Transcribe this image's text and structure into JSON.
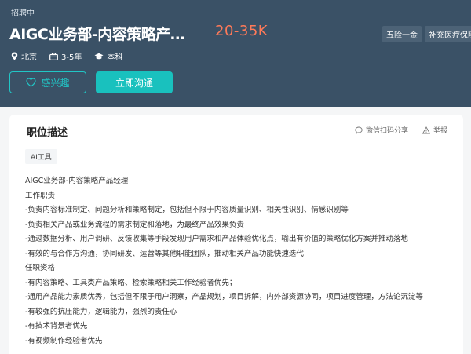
{
  "header": {
    "status": "招聘中",
    "title": "AIGC业务部-内容策略产品经理",
    "salary": "20-35K",
    "tags": [
      "五险一金",
      "补充医疗保险"
    ],
    "meta": {
      "location": "北京",
      "experience": "3-5年",
      "education": "本科"
    },
    "interest_button": "感兴趣",
    "chat_button": "立即沟通"
  },
  "card": {
    "title": "职位描述",
    "actions": {
      "share": "微信扫码分享",
      "report": "举报"
    },
    "skill_tag": "AI工具",
    "lines": [
      "AIGC业务部-内容策略产品经理",
      "工作职责",
      "-负责内容标准制定、问题分析和策略制定，包括但不限于内容质量识别、相关性识别、情感识别等",
      "-负责相关产品或业务流程的需求制定和落地，为最终产品效果负责",
      "-通过数据分析、用户调研、反馈收集等手段发现用户需求和产品体验优化点，输出有价值的策略优化方案并推动落地",
      "-有效的与合作方沟通，协同研发、运营等其他职能团队，推动相关产品功能快速迭代",
      "任职资格",
      "-有内容策略、工具类产品策略、检索策略相关工作经验者优先；",
      "-通用产品能力素质优秀，包括但不限于用户洞察，产品规划，项目拆解，内外部资源协同，项目进度管理，方法论沉淀等",
      "-有较强的抗压能力，逻辑能力，强烈的责任心",
      "-有技术背景者优先",
      "-有视频制作经验者优先"
    ]
  },
  "colors": {
    "header_bg": "#3a5166",
    "accent": "#19c1be",
    "salary": "#ff7a59"
  }
}
